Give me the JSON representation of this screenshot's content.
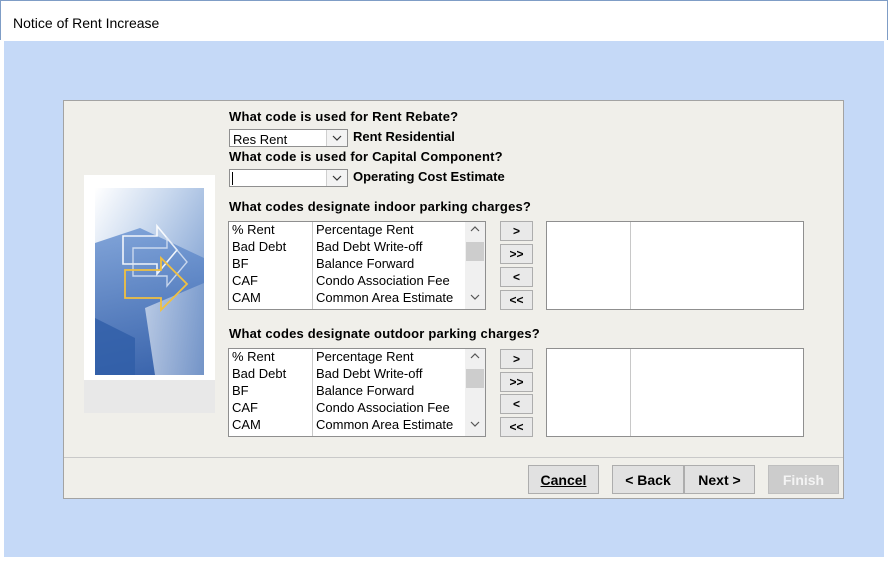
{
  "window": {
    "title": "Notice of Rent Increase"
  },
  "rebate": {
    "question": "What code is used for Rent Rebate?",
    "value": "Res Rent",
    "description": "Rent Residential"
  },
  "capital": {
    "question": "What code is used for Capital Component?",
    "value": "",
    "description": "Operating Cost Estimate"
  },
  "indoor": {
    "question": "What codes designate indoor parking charges?",
    "available": [
      {
        "code": "% Rent",
        "desc": "Percentage Rent"
      },
      {
        "code": "Bad Debt",
        "desc": "Bad Debt Write-off"
      },
      {
        "code": "BF",
        "desc": "Balance Forward"
      },
      {
        "code": "CAF",
        "desc": "Condo Association Fee"
      },
      {
        "code": "CAM",
        "desc": "Common Area Estimate"
      }
    ]
  },
  "outdoor": {
    "question": "What codes designate outdoor parking charges?",
    "available": [
      {
        "code": "% Rent",
        "desc": "Percentage Rent"
      },
      {
        "code": "Bad Debt",
        "desc": "Bad Debt Write-off"
      },
      {
        "code": "BF",
        "desc": "Balance Forward"
      },
      {
        "code": "CAF",
        "desc": "Condo Association Fee"
      },
      {
        "code": "CAM",
        "desc": "Common Area Estimate"
      }
    ]
  },
  "move_buttons": {
    "add": ">",
    "add_all": ">>",
    "remove": "<",
    "remove_all": "<<"
  },
  "nav": {
    "cancel": "Cancel",
    "back": "< Back",
    "next": "Next >",
    "finish": "Finish"
  },
  "colors": {
    "desktop": "#c5d9f7",
    "panel": "#f0efea",
    "accent": "#f0c040"
  }
}
